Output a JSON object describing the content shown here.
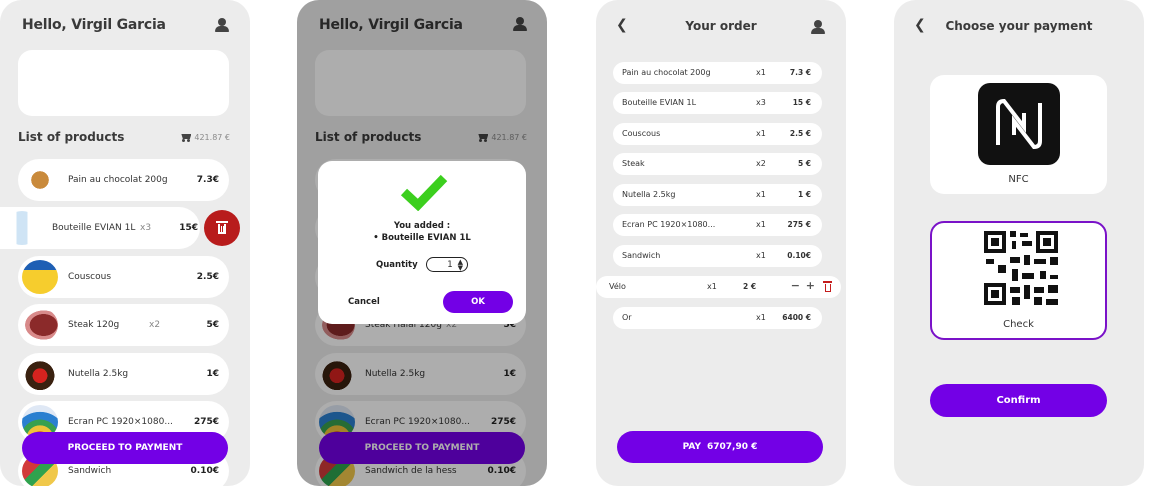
{
  "screen1": {
    "greeting": "Hello, Virgil Garcia",
    "section_title": "List of products",
    "cart_total": "421.87 €",
    "products": [
      {
        "name": "Pain au chocolat 200g",
        "qty": "",
        "price": "7.3€"
      },
      {
        "name": "Bouteille EVIAN 1L",
        "qty": "x3",
        "price": "15€"
      },
      {
        "name": "Couscous",
        "qty": "",
        "price": "2.5€"
      },
      {
        "name": "Steak 120g",
        "qty": "x2",
        "price": "5€"
      },
      {
        "name": "Nutella 2.5kg",
        "qty": "",
        "price": "1€"
      },
      {
        "name": "Ecran PC 1920×1080...",
        "qty": "",
        "price": "275€"
      },
      {
        "name": "Sandwich",
        "qty": "",
        "price": "0.10€"
      }
    ],
    "proceed_label": "PROCEED TO PAYMENT"
  },
  "screen2": {
    "greeting": "Hello, Virgil Garcia",
    "section_title": "List of products",
    "cart_total": "421.87 €",
    "products": [
      {
        "name": "Steak Halal 120g",
        "qty": "x2",
        "price": "5€"
      },
      {
        "name": "Nutella 2.5kg",
        "qty": "",
        "price": "1€"
      },
      {
        "name": "Ecran PC 1920×1080...",
        "qty": "",
        "price": "275€"
      },
      {
        "name": "Sandwich de la hess",
        "qty": "",
        "price": "0.10€"
      }
    ],
    "proceed_label": "PROCEED TO PAYMENT",
    "modal": {
      "title": "You added :",
      "item": "• Bouteille EVIAN 1L",
      "quantity_label": "Quantity",
      "quantity_value": "1",
      "cancel_label": "Cancel",
      "ok_label": "OK"
    }
  },
  "screen3": {
    "title": "Your order",
    "items": [
      {
        "name": "Pain au chocolat 200g",
        "qty": "x1",
        "price": "7.3 €"
      },
      {
        "name": "Bouteille EVIAN 1L",
        "qty": "x3",
        "price": "15 €"
      },
      {
        "name": "Couscous",
        "qty": "x1",
        "price": "2.5 €"
      },
      {
        "name": "Steak",
        "qty": "x2",
        "price": "5 €"
      },
      {
        "name": "Nutella 2.5kg",
        "qty": "x1",
        "price": "1 €"
      },
      {
        "name": "Ecran PC 1920×1080...",
        "qty": "x1",
        "price": "275 €"
      },
      {
        "name": "Sandwich",
        "qty": "x1",
        "price": "0.10€"
      },
      {
        "name": "Vélo",
        "qty": "x1",
        "price": "2 €"
      },
      {
        "name": "Or",
        "qty": "x1",
        "price": "6400 €"
      }
    ],
    "pay_label": "PAY",
    "pay_total": "6707,90 €"
  },
  "screen4": {
    "title": "Choose your payment",
    "options": [
      {
        "label": "NFC",
        "selected": false
      },
      {
        "label": "Check",
        "selected": true
      }
    ],
    "confirm_label": "Confirm"
  },
  "colors": {
    "accent": "#7300e6",
    "delete": "#b81c1c",
    "check_green": "#3ccf1e",
    "phone_bg": "#ececec",
    "selected_border": "#7a12c8"
  },
  "icons": [
    "user-icon",
    "cart-icon",
    "trash-icon",
    "checkmark-icon",
    "back-arrow-icon",
    "nfc-icon",
    "qr-code-icon"
  ]
}
